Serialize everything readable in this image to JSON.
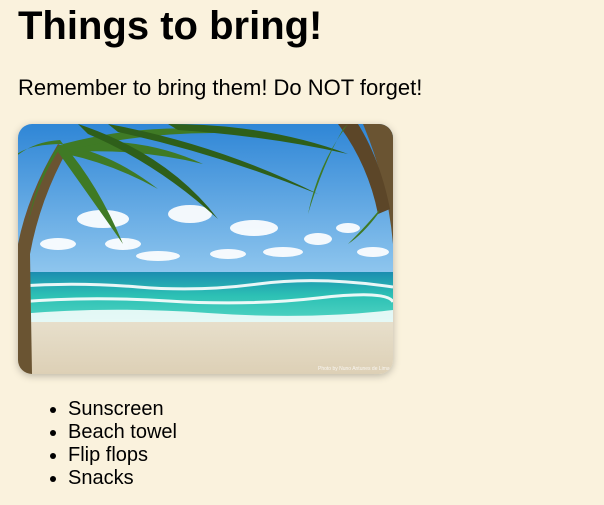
{
  "heading": "Things to bring!",
  "subtitle": "Remember to bring them! Do NOT forget!",
  "image": {
    "subject": "tropical beach with palm trees",
    "credit": "Photo by Nuno Antunes de Lima"
  },
  "items": [
    "Sunscreen",
    "Beach towel",
    "Flip flops",
    "Snacks"
  ],
  "colors": {
    "background": "#faf2dd",
    "text": "#000000"
  }
}
